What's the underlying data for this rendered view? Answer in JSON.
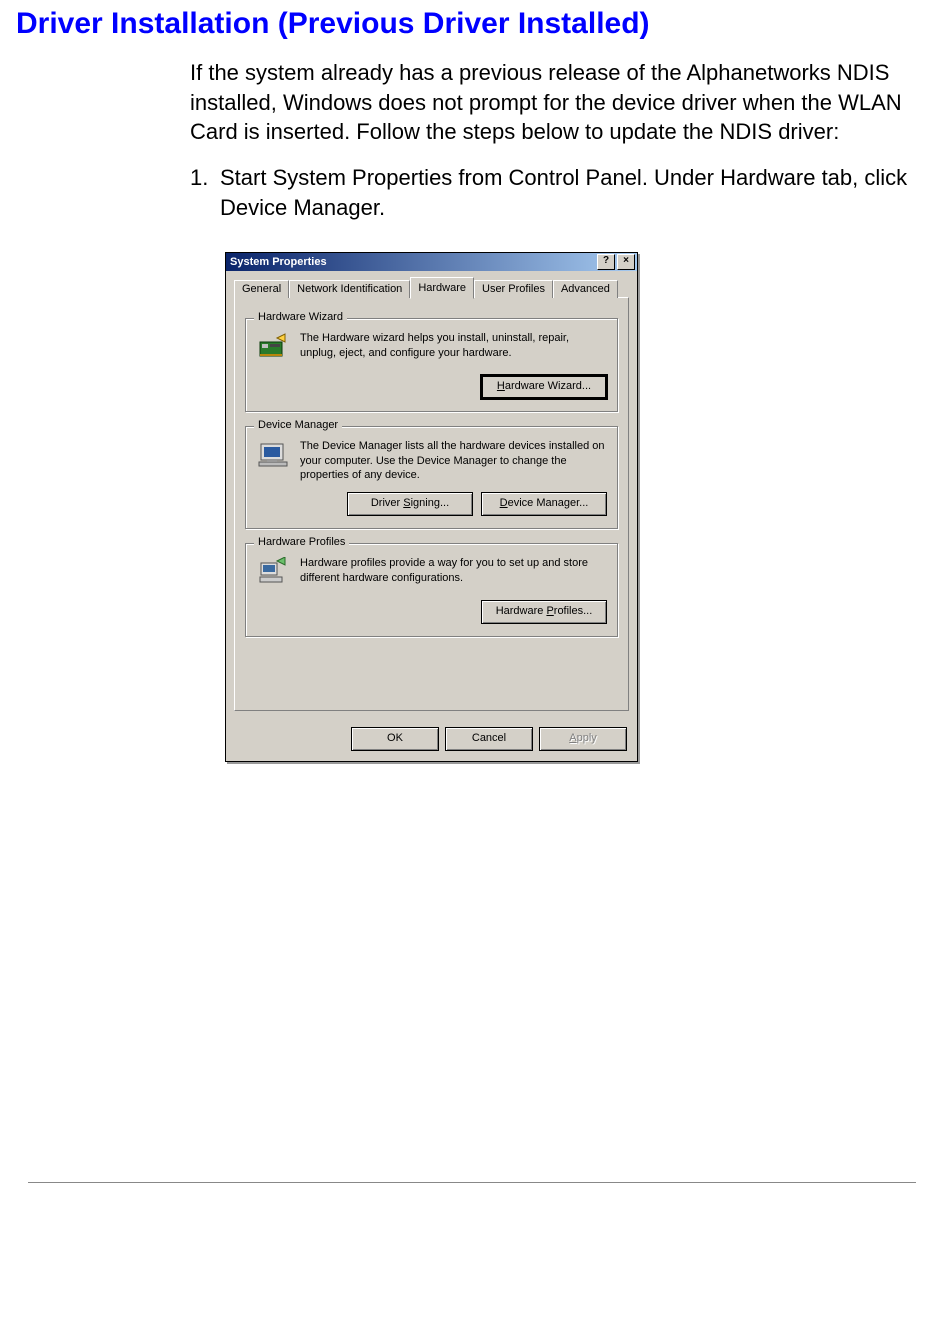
{
  "heading": "Driver Installation (Previous Driver Installed)",
  "intro": "If the system already has a previous release of the Alphanetworks NDIS installed, Windows does not prompt for the device driver when the WLAN Card is inserted. Follow the steps below to update the NDIS driver:",
  "step1_num": "1.",
  "step1_text": "Start System Properties from Control Panel. Under Hardware tab, click Device Manager.",
  "dialog": {
    "title": "System Properties",
    "help_btn": "?",
    "close_btn": "×",
    "tabs": {
      "general": "General",
      "netid": "Network Identification",
      "hardware": "Hardware",
      "profiles": "User Profiles",
      "advanced": "Advanced"
    },
    "hw_wizard": {
      "title": "Hardware Wizard",
      "desc": "The Hardware wizard helps you install, uninstall, repair, unplug, eject, and configure your hardware.",
      "button": "Hardware Wizard..."
    },
    "dev_mgr": {
      "title": "Device Manager",
      "desc": "The Device Manager lists all the hardware devices installed on your computer. Use the Device Manager to change the properties of any device.",
      "signing_btn": "Driver Signing...",
      "devmgr_btn": "Device Manager..."
    },
    "hw_profiles": {
      "title": "Hardware Profiles",
      "desc": "Hardware profiles provide a way for you to set up and store different hardware configurations.",
      "button": "Hardware Profiles..."
    },
    "footer": {
      "ok": "OK",
      "cancel": "Cancel",
      "apply": "Apply"
    }
  }
}
